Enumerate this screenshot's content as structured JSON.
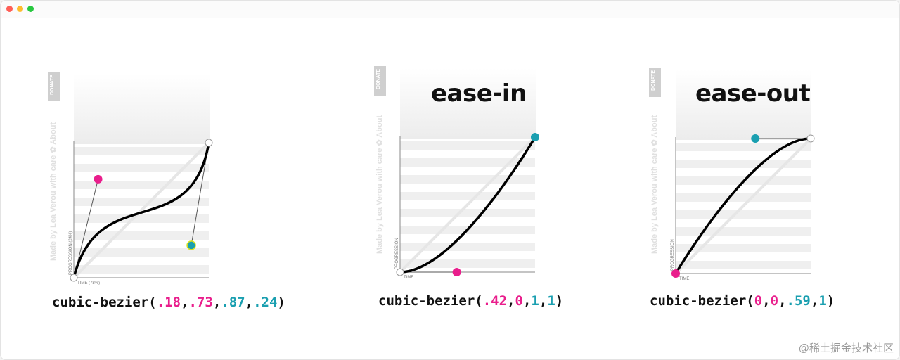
{
  "window": {
    "traffic_lights": [
      {
        "name": "close",
        "color": "#ff5f57"
      },
      {
        "name": "minimize",
        "color": "#febc2e"
      },
      {
        "name": "zoom",
        "color": "#28c840"
      }
    ]
  },
  "panels": [
    {
      "id": "custom",
      "title": "",
      "donate": "DONATE",
      "side_text": "Made by Lea Verou with care ✿ About",
      "axis_y": "PROGRESSION (24%)",
      "axis_x": "TIME (78%)",
      "function": {
        "name": "cubic-bezier",
        "args": [
          ".18",
          ".73",
          ".87",
          ".24"
        ]
      },
      "curve": {
        "p1": [
          0.18,
          0.73
        ],
        "p2": [
          0.87,
          0.24
        ]
      },
      "handle_colors": [
        "#e91e8c",
        "#1a9fb0"
      ]
    },
    {
      "id": "ease-in",
      "title": "ease-in",
      "donate": "DONATE",
      "side_text": "Made by Lea Verou with care ✿ About",
      "axis_y": "PROGRESSION",
      "axis_x": "TIME",
      "function": {
        "name": "cubic-bezier",
        "args": [
          ".42",
          "0",
          "1",
          "1"
        ]
      },
      "curve": {
        "p1": [
          0.42,
          0
        ],
        "p2": [
          1,
          1
        ]
      },
      "handle_colors": [
        "#e91e8c",
        "#1a9fb0"
      ]
    },
    {
      "id": "ease-out",
      "title": "ease-out",
      "donate": "DONATE",
      "side_text": "Made by Lea Verou with care ✿ About",
      "axis_y": "PROGRESSION",
      "axis_x": "TIME",
      "function": {
        "name": "cubic-bezier",
        "args": [
          "0",
          "0",
          ".59",
          "1"
        ]
      },
      "curve": {
        "p1": [
          0,
          0
        ],
        "p2": [
          0.59,
          1
        ]
      },
      "handle_colors": [
        "#e91e8c",
        "#1a9fb0"
      ]
    }
  ],
  "watermark": "@稀土掘金技术社区"
}
